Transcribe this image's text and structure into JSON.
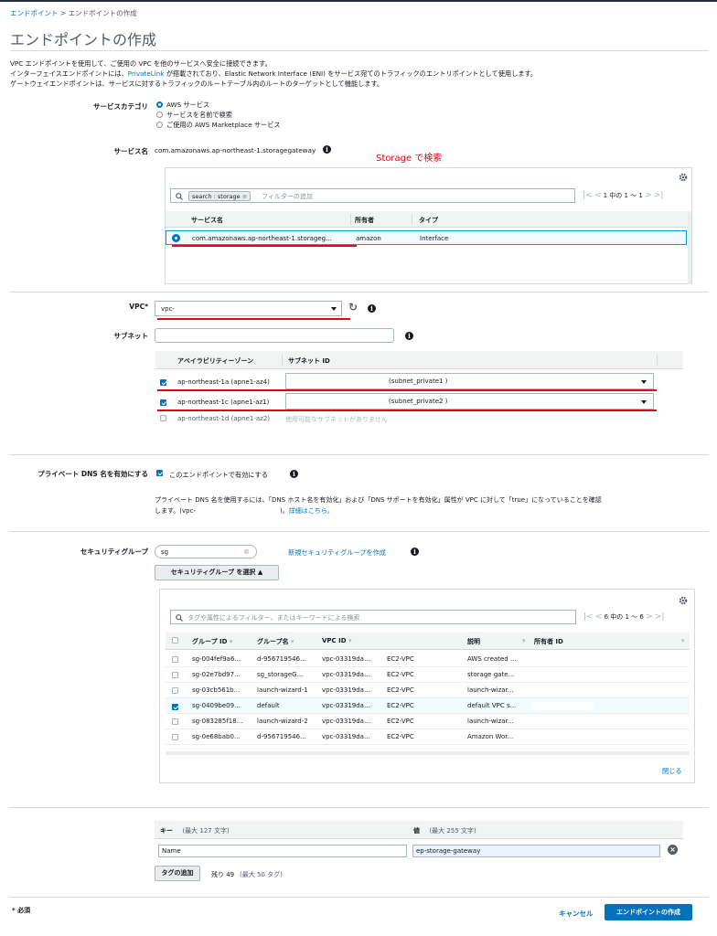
{
  "breadcrumb": {
    "parent": "エンドポイント",
    "separator": ">",
    "current": "エンドポイントの作成"
  },
  "page_title": "エンドポイントの作成",
  "description": [
    "VPC エンドポイントを使用して、ご使用の VPC を他のサービスへ安全に接続できます。",
    "インターフェイスエンドポイントには、",
    "PrivateLink",
    " が搭載されており、Elastic Network Interface (ENI) をサービス宛てのトラフィックのエントリポイントとして使用します。",
    "ゲートウェイエンドポイントは、サービスに対するトラフィックのルートテーブル内のルートのターゲットとして機能します。"
  ],
  "service_category": {
    "label": "サービスカテゴリ",
    "options": [
      "AWS サービス",
      "サービスを名前で検索",
      "ご使用の AWS Marketplace サービス"
    ],
    "selected_index": 0
  },
  "service_name": {
    "label": "サービス名",
    "value": "com.amazonaws.ap-northeast-1.storagegateway"
  },
  "annotation": {
    "text": "Storage で検索",
    "color": "#e8001c"
  },
  "service_table": {
    "search_token": "search : storage",
    "search_placeholder": "フィルターの追加",
    "pager_text": "1 中の 1 ～ 1",
    "columns": [
      "サービス名",
      "所有者",
      "タイプ"
    ],
    "rows": [
      {
        "name": "com.amazonaws.ap-northeast-1.storageg...",
        "owner": "amazon",
        "type": "Interface",
        "selected": true
      }
    ]
  },
  "vpc": {
    "label": "VPC*",
    "value": "vpc-"
  },
  "subnet": {
    "label": "サブネット",
    "columns": [
      "アベイラビリティーゾーン",
      "サブネット ID"
    ],
    "rows": [
      {
        "az": "ap-northeast-1a (apne1-az4)",
        "subnet": "(subnet_private1 )",
        "checked": true,
        "enabled": true
      },
      {
        "az": "ap-northeast-1c (apne1-az1)",
        "subnet": "(subnet_private2 )",
        "checked": true,
        "enabled": true
      },
      {
        "az": "ap-northeast-1d (apne1-az2)",
        "subnet": "使用可能なサブネットがありません",
        "checked": false,
        "enabled": false
      }
    ]
  },
  "private_dns": {
    "label": "プライベート DNS 名を有効にする",
    "checkbox_label": "このエンドポイントで有効にする",
    "checked": true,
    "note_line1": "プライベート DNS 名を使用するには、「DNS ホスト名を有効化」および「DNS サポートを有効化」属性が VPC に対して「true」になっていることを確認",
    "note_line2_prefix": "します。(vpc-",
    "note_line2_suffix": ")。",
    "note_link": "詳細はこちら。"
  },
  "security_group": {
    "label": "セキュリティグループ",
    "input_value": "sg",
    "create_link": "新規セキュリティグループを作成",
    "select_button": "セキュリティグループ を選択",
    "search_placeholder": "タグや属性によるフィルター、またはキーワードによる検索",
    "pager_text": "6 中の 1 ～ 6",
    "columns": [
      "グループ ID",
      "グループ名",
      "VPC ID",
      "説明",
      "所有者 ID"
    ],
    "rows": [
      {
        "id": "sg-004fef9a6...",
        "name": "d-956719546...",
        "vpc": "vpc-03319da...",
        "vpcname": "EC2-VPC",
        "desc": "AWS created ...",
        "selected": false
      },
      {
        "id": "sg-02e7bd97...",
        "name": "sg_storageG...",
        "vpc": "vpc-03319da...",
        "vpcname": "EC2-VPC",
        "desc": "storage gate...",
        "selected": false
      },
      {
        "id": "sg-03cb561b...",
        "name": "launch-wizard-1",
        "vpc": "vpc-03319da...",
        "vpcname": "EC2-VPC",
        "desc": "launch-wizar...",
        "selected": false
      },
      {
        "id": "sg-0409be09...",
        "name": "default",
        "vpc": "vpc-03319da...",
        "vpcname": "EC2-VPC",
        "desc": "default VPC s...",
        "selected": true
      },
      {
        "id": "sg-083285f18...",
        "name": "launch-wizard-2",
        "vpc": "vpc-03319da...",
        "vpcname": "EC2-VPC",
        "desc": "launch-wizar...",
        "selected": false
      },
      {
        "id": "sg-0e68bab0...",
        "name": "d-956719546...",
        "vpc": "vpc-03319da...",
        "vpcname": "EC2-VPC",
        "desc": "Amazon Wor...",
        "selected": false
      }
    ],
    "close_link": "閉じる"
  },
  "tags": {
    "key_header": "キー",
    "key_limit": "(最大 127 文字)",
    "value_header": "値",
    "value_limit": "(最大 255 文字)",
    "key_value": "Name",
    "value_value": "ep-storage-gateway",
    "add_button": "タグの追加",
    "remaining": "残り 49",
    "remaining_note": "(最大 50 タグ)"
  },
  "footer": {
    "required_note": "* 必須",
    "cancel": "キャンセル",
    "create": "エンドポイントの作成"
  }
}
